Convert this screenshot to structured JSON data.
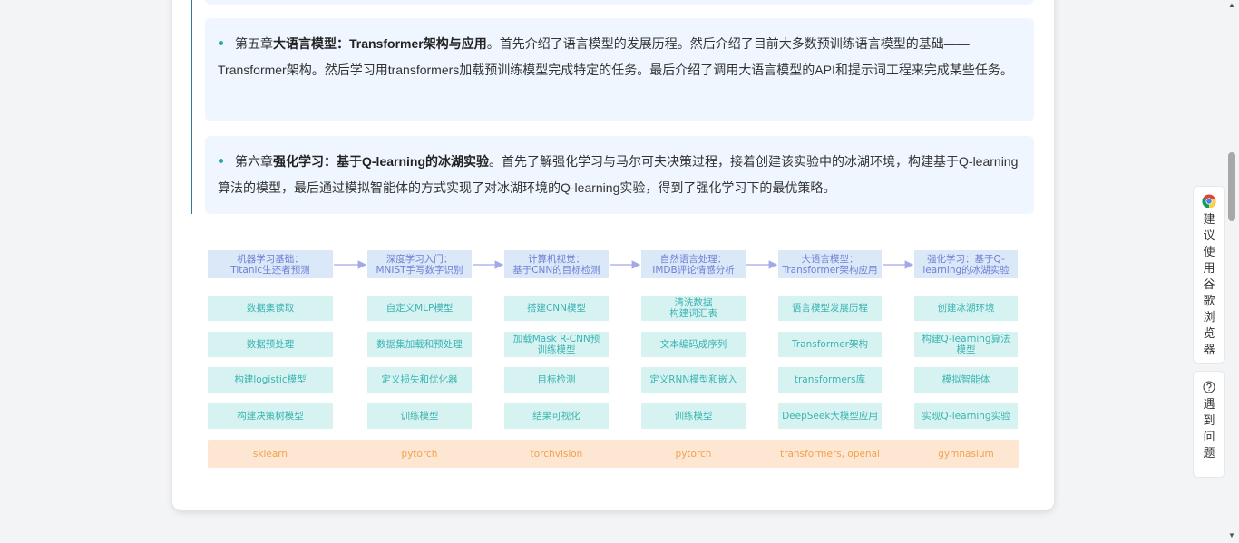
{
  "chapters": [
    {
      "prefix": "第五章",
      "title": "大语言模型：Transformer架构与应用",
      "text": "。首先介绍了语言模型的发展历程。然后介绍了目前大多数预训练语言模型的基础——Transformer架构。然后学习用transformers加载预训练模型完成特定的任务。最后介绍了调用大语言模型的API和提示词工程来完成某些任务。"
    },
    {
      "prefix": "第六章",
      "title": "强化学习：基于Q-learning的冰湖实验",
      "text": "。首先了解强化学习与马尔可夫决策过程，接着创建该实验中的冰湖环境，构建基于Q-learning算法的模型，最后通过模拟智能体的方式实现了对冰湖环境的Q-learning实验，得到了强化学习下的最优策略。"
    }
  ],
  "diagram": {
    "headers": [
      "机器学习基础：\nTitanic生还者预测",
      "深度学习入门：\nMNIST手写数字识别",
      "计算机视觉：\n基于CNN的目标检测",
      "自然语言处理：\nIMDB评论情感分析",
      "大语言模型：\nTransformer架构应用",
      "强化学习：基于Q-\nlearning的冰湖实验"
    ],
    "tasks": [
      [
        "数据集读取",
        "数据预处理",
        "构建logistic模型",
        "构建决策树模型"
      ],
      [
        "自定义MLP模型",
        "数据集加载和预处理",
        "定义损失和优化器",
        "训练模型"
      ],
      [
        "搭建CNN模型",
        "加载Mask R-CNN预\n训练模型",
        "目标检测",
        "结果可视化"
      ],
      [
        "清洗数据\n构建词汇表",
        "文本编码成序列",
        "定义RNN模型和嵌入",
        "训练模型"
      ],
      [
        "语言模型发展历程",
        "Transformer架构",
        "transformers库",
        "DeepSeek大模型应用"
      ],
      [
        "创建冰湖环境",
        "构建Q-learning算法\n模型",
        "模拟智能体",
        "实现Q-learning实验"
      ]
    ],
    "libs": [
      "sklearn",
      "pytorch",
      "torchvision",
      "pytorch",
      "transformers, openai",
      "gymnasium"
    ]
  },
  "sidebar": {
    "recommend_label": "建议使用谷歌浏览器",
    "chrome_icon": "chrome-icon",
    "help_label": "遇到问题",
    "help_icon": "question-circle-icon"
  }
}
